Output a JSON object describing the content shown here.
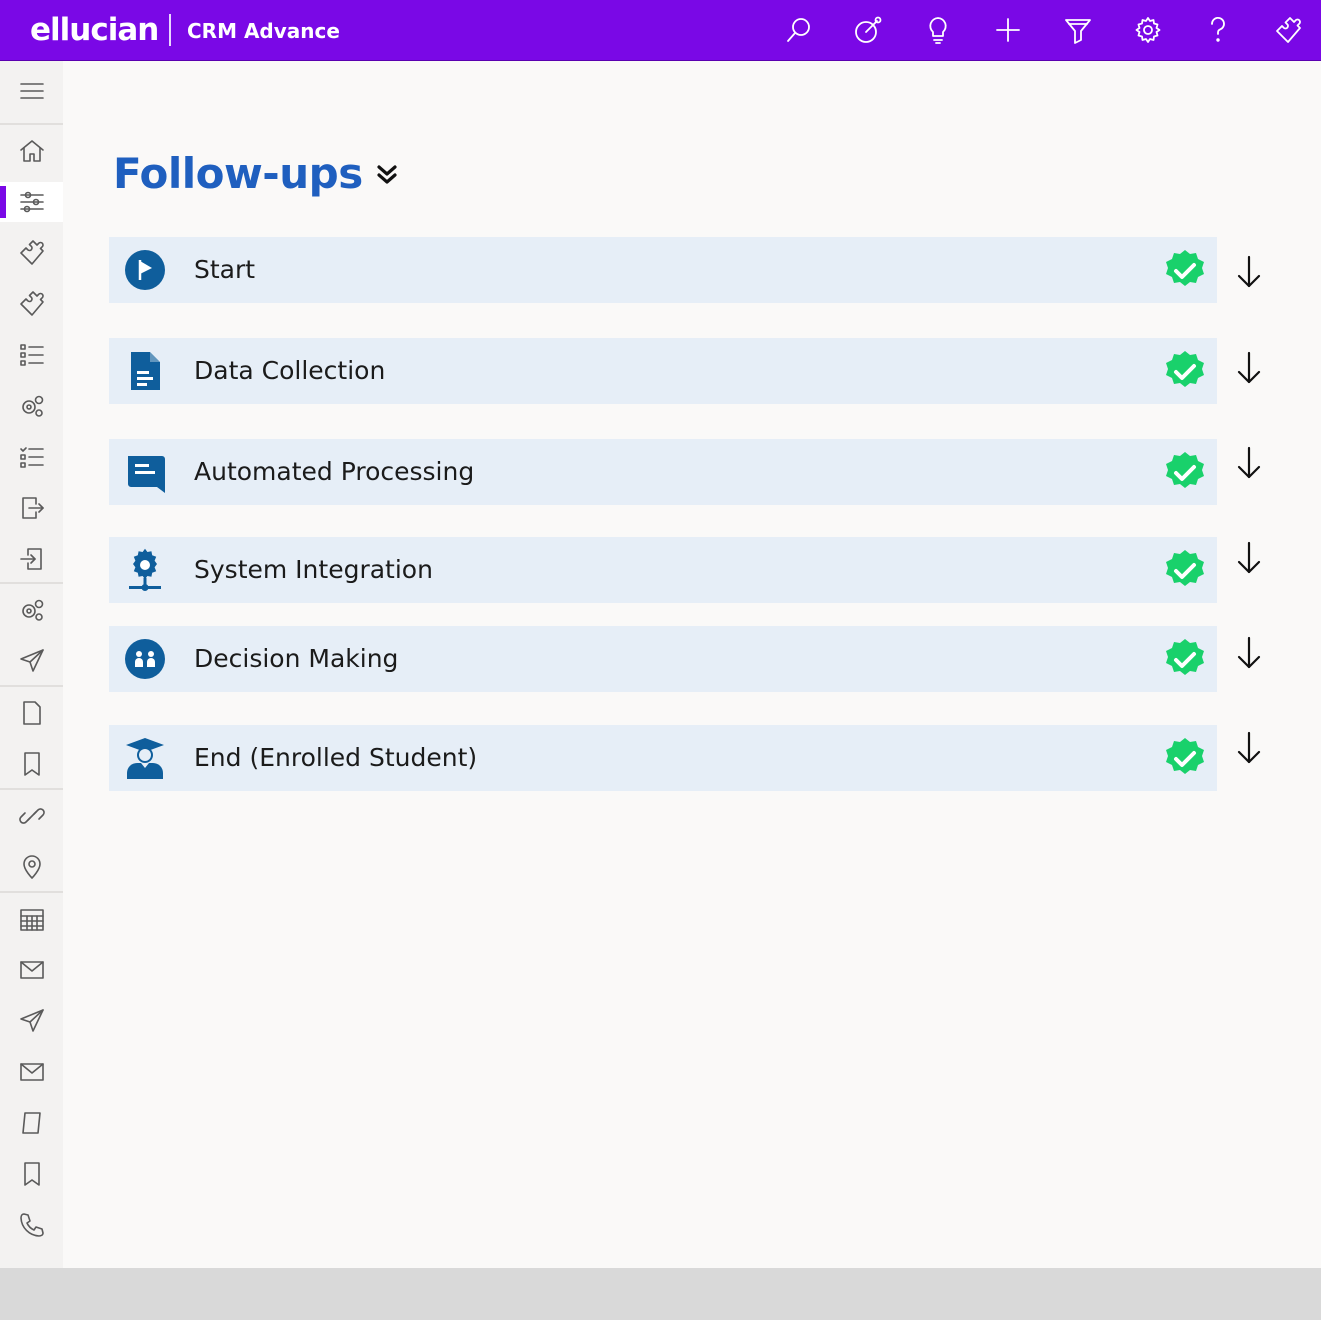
{
  "header": {
    "logo_text": "ellucian",
    "product_name": "CRM Advance",
    "icons": [
      "search-icon",
      "target-icon",
      "lightbulb-icon",
      "plus-icon",
      "filter-icon",
      "gear-icon",
      "help-icon",
      "puzzle-icon"
    ]
  },
  "sidebar": {
    "items": [
      "menu-icon",
      "home-icon",
      "sliders-icon",
      "puzzle-icon",
      "puzzle-icon",
      "list-icon",
      "gears-icon",
      "checklist-icon",
      "export-icon",
      "import-icon",
      "gears-icon",
      "send-icon",
      "document-icon",
      "bookmark-icon",
      "link-icon",
      "location-icon",
      "calendar-icon",
      "mail-icon",
      "send-icon",
      "mail-icon",
      "document-icon",
      "bookmark-icon",
      "phone-icon"
    ],
    "active_index": 2
  },
  "main": {
    "title": "Follow-ups",
    "steps": [
      {
        "label": "Start",
        "icon": "flag-circle-icon",
        "status": "complete"
      },
      {
        "label": "Data Collection",
        "icon": "document-icon",
        "status": "complete"
      },
      {
        "label": "Automated Processing",
        "icon": "chat-icon",
        "status": "complete"
      },
      {
        "label": "System Integration",
        "icon": "gear-network-icon",
        "status": "complete"
      },
      {
        "label": "Decision Making",
        "icon": "people-circle-icon",
        "status": "complete"
      },
      {
        "label": "End (Enrolled Student)",
        "icon": "graduate-icon",
        "status": "complete"
      }
    ]
  },
  "colors": {
    "brand": "#7a08e6",
    "title": "#1f5fbf",
    "icon_blue": "#0f5e9c",
    "step_bg": "#e6eef7",
    "check_green": "#19d16b"
  }
}
